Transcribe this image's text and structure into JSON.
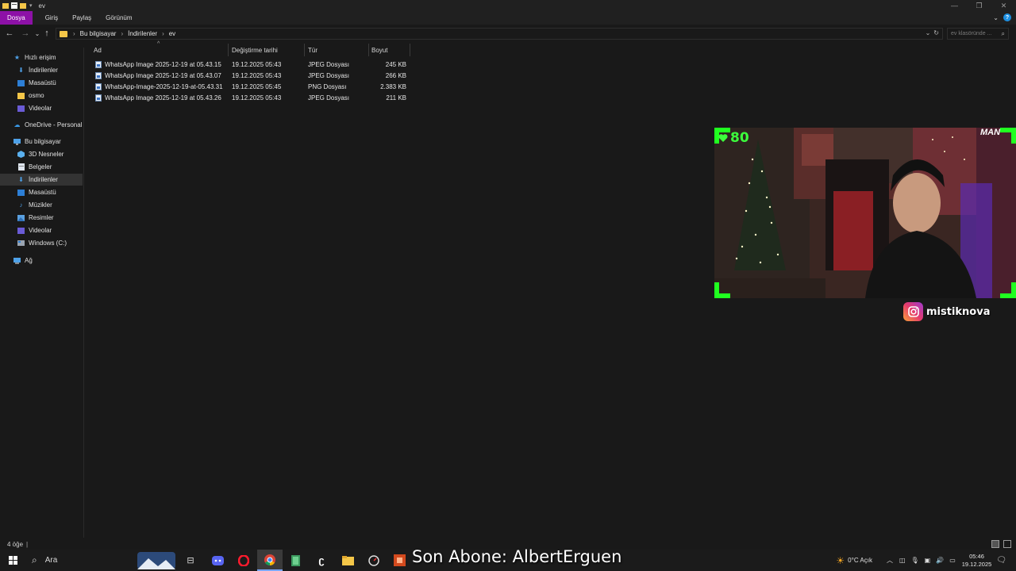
{
  "window": {
    "title": "ev",
    "controls": [
      "minimize-icon",
      "restore-icon",
      "close-icon"
    ]
  },
  "ribbon": {
    "tabs": [
      "Dosya",
      "Giriş",
      "Paylaş",
      "Görünüm"
    ]
  },
  "address": {
    "breadcrumbs": [
      "Bu bilgisayar",
      "İndirilenler",
      "ev"
    ],
    "search_placeholder": "ev klasöründe ..."
  },
  "sidebar": {
    "items": [
      {
        "label": "Hızlı erişim",
        "icon": "star-icon"
      },
      {
        "label": "İndirilenler",
        "icon": "download-icon"
      },
      {
        "label": "Masaüstü",
        "icon": "desktop-icon"
      },
      {
        "label": "osmo",
        "icon": "folder-icon"
      },
      {
        "label": "Videolar",
        "icon": "video-folder-icon"
      },
      {
        "label": "OneDrive - Personal",
        "icon": "cloud-icon"
      },
      {
        "label": "Bu bilgisayar",
        "icon": "computer-icon"
      },
      {
        "label": "3D Nesneler",
        "icon": "cube-icon"
      },
      {
        "label": "Belgeler",
        "icon": "document-icon"
      },
      {
        "label": "İndirilenler",
        "icon": "download-icon"
      },
      {
        "label": "Masaüstü",
        "icon": "desktop-icon"
      },
      {
        "label": "Müzikler",
        "icon": "music-icon"
      },
      {
        "label": "Resimler",
        "icon": "pictures-icon"
      },
      {
        "label": "Videolar",
        "icon": "video-folder-icon"
      },
      {
        "label": "Windows (C:)",
        "icon": "drive-icon"
      },
      {
        "label": "Ağ",
        "icon": "network-icon"
      }
    ]
  },
  "filelist": {
    "columns": [
      "Ad",
      "Değiştirme tarihi",
      "Tür",
      "Boyut"
    ],
    "rows": [
      {
        "name": "WhatsApp Image 2025-12-19 at 05.43.15",
        "date": "19.12.2025 05:43",
        "type": "JPEG Dosyası",
        "size": "245 KB"
      },
      {
        "name": "WhatsApp Image 2025-12-19 at 05.43.07",
        "date": "19.12.2025 05:43",
        "type": "JPEG Dosyası",
        "size": "266 KB"
      },
      {
        "name": "WhatsApp-Image-2025-12-19-at-05.43.31",
        "date": "19.12.2025 05:45",
        "type": "PNG Dosyası",
        "size": "2.383 KB"
      },
      {
        "name": "WhatsApp Image 2025-12-19 at 05.43.26",
        "date": "19.12.2025 05:43",
        "type": "JPEG Dosyası",
        "size": "211 KB"
      }
    ]
  },
  "status": {
    "item_count": "4 öğe"
  },
  "overlay": {
    "viewers": "80",
    "cam_tag": "MAN",
    "instagram": "mistiknova",
    "last_sub": "Son Abone: AlbertErguen",
    "accent": "#20ff20"
  },
  "taskbar": {
    "search_label": "Ara",
    "weather": "0°C  Açık",
    "time": "05:46",
    "date": "19.12.2025"
  }
}
